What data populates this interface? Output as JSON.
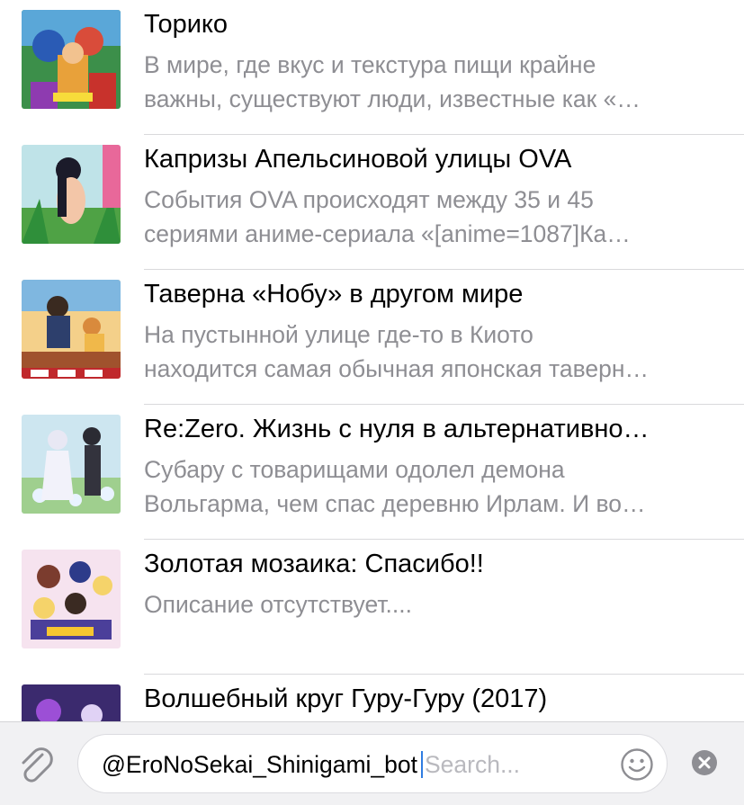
{
  "results": [
    {
      "title": "Торико",
      "desc_line1": "В мире, где вкус и текстура пищи крайне",
      "desc_line2": "важны, существуют люди, известные как «…",
      "thumb_icon": "toriko-poster-image"
    },
    {
      "title": "Капризы Апельсиновой улицы OVA",
      "desc_line1": "События OVA происходят между 35 и 45",
      "desc_line2": "сериями аниме-сериала «[anime=1087]Ка…",
      "thumb_icon": "kimagure-orange-road-poster-image"
    },
    {
      "title": "Таверна «Нобу» в другом мире",
      "desc_line1": "На пустынной улице где-то в Киото",
      "desc_line2": "находится самая обычная японская таверн…",
      "thumb_icon": "isekai-izakaya-poster-image"
    },
    {
      "title": "Re:Zero. Жизнь с нуля в альтернативно…",
      "desc_line1": "Субару с товарищами одолел демона",
      "desc_line2": "Вольгарма, чем спас деревню Ирлам. И во…",
      "thumb_icon": "rezero-poster-image"
    },
    {
      "title": "Золотая мозаика: Спасибо!!",
      "desc_line1": "Описание отсутствует....",
      "desc_line2": "",
      "thumb_icon": "kiniro-mosaic-poster-image"
    },
    {
      "title": "Волшебный круг Гуру-Гуру (2017)",
      "desc_line1": "",
      "desc_line2": "",
      "thumb_icon": "guru-guru-poster-image"
    }
  ],
  "input": {
    "typed": "@EroNoSekai_Shinigami_bot",
    "placeholder": "Search..."
  },
  "icons": {
    "attach": "paperclip-icon",
    "emoji": "smiley-icon",
    "clear": "clear-circle-icon"
  },
  "colors": {
    "accent": "#2f7de1",
    "secondary_text": "#8e8e93",
    "input_bar_bg": "#f1f1f3"
  }
}
